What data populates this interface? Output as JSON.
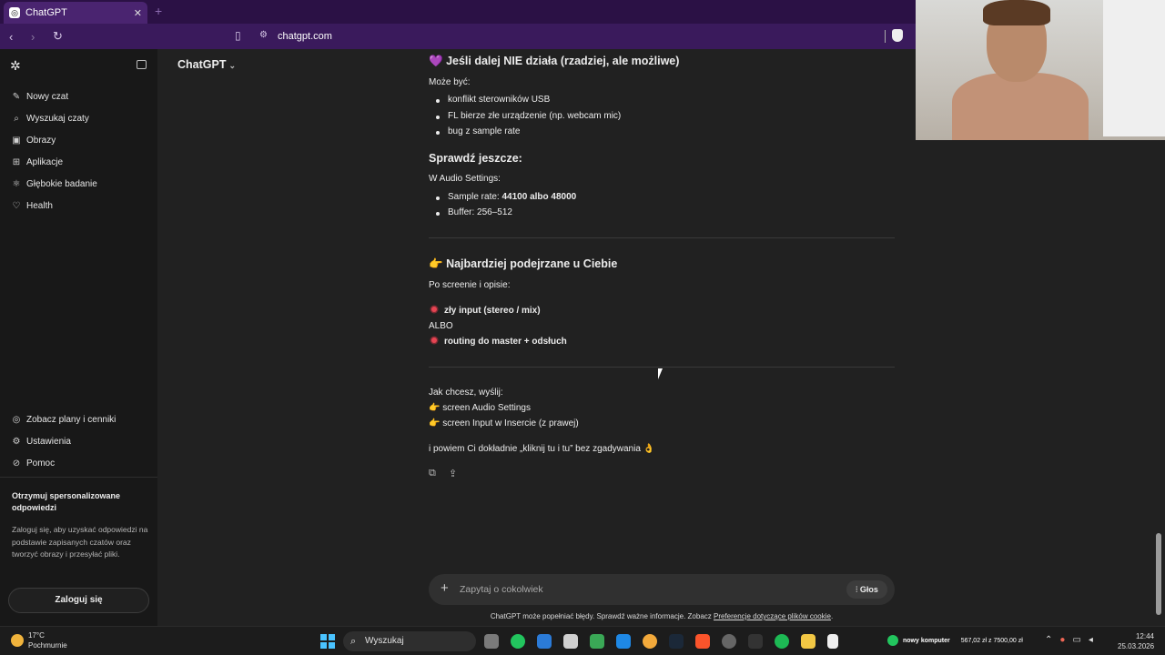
{
  "browser": {
    "tab_title": "ChatGPT",
    "url": "chatgpt.com"
  },
  "sidebar": {
    "items": [
      {
        "label": "Nowy czat",
        "icon": "pencil-icon"
      },
      {
        "label": "Wyszukaj czaty",
        "icon": "search-icon"
      },
      {
        "label": "Obrazy",
        "icon": "image-icon"
      },
      {
        "label": "Aplikacje",
        "icon": "apps-icon"
      },
      {
        "label": "Głębokie badanie",
        "icon": "atom-icon"
      },
      {
        "label": "Health",
        "icon": "heart-icon"
      }
    ],
    "bottom_items": [
      {
        "label": "Zobacz plany i cenniki",
        "icon": "plans-icon"
      },
      {
        "label": "Ustawienia",
        "icon": "gear-icon"
      },
      {
        "label": "Pomoc",
        "icon": "help-icon"
      }
    ],
    "promo_title": "Otrzymuj spersonalizowane odpowiedzi",
    "promo_text": "Zaloguj się, aby uzyskać odpowiedzi na podstawie zapisanych czatów oraz tworzyć obrazy i przesyłać pliki.",
    "login_label": "Zaloguj się"
  },
  "header": {
    "model": "ChatGPT"
  },
  "message": {
    "h_fallback": "Jeśli dalej NIE działa (rzadziej, ale możliwe)",
    "fallback_intro": "Może być:",
    "fallback_items": [
      "konflikt sterowników USB",
      "FL bierze złe urządzenie (np. webcam mic)",
      "bug z sample rate"
    ],
    "h_check": "Sprawdź jeszcze:",
    "check_intro": "W Audio Settings:",
    "check_sample_prefix": "Sample rate: ",
    "check_sample_value": "44100 albo 48000",
    "check_buffer": "Buffer: 256–512",
    "h_suspect": "Najbardziej podejrzane u Ciebie",
    "suspect_intro": "Po screenie i opisie:",
    "suspect_a": "zły input (stereo / mix)",
    "suspect_or": "ALBO",
    "suspect_b": "routing do master + odsłuch",
    "closing_intro": "Jak chcesz, wyślij:",
    "closing_item1": "screen Audio Settings",
    "closing_item2": "screen Input w Insercie (z prawej)",
    "closing_final": "i powiem Ci dokładnie „kliknij tu i tu” bez zgadywania 👌"
  },
  "composer": {
    "placeholder": "Zapytaj o cokolwiek",
    "voice_label": "Głos"
  },
  "disclaimer": {
    "text": "ChatGPT może popełniać błędy. Sprawdź ważne informacje. Zobacz ",
    "link": "Preferencje dotyczące plików cookie",
    "suffix": "."
  },
  "taskbar": {
    "weather_temp": "17°C",
    "weather_desc": "Pochmurnie",
    "search_label": "Wyszukaj",
    "status_name": "nowy komputer",
    "status_value": "567,02 zł z 7500,00 zł",
    "time": "12:44",
    "date": "25.03.2026"
  }
}
